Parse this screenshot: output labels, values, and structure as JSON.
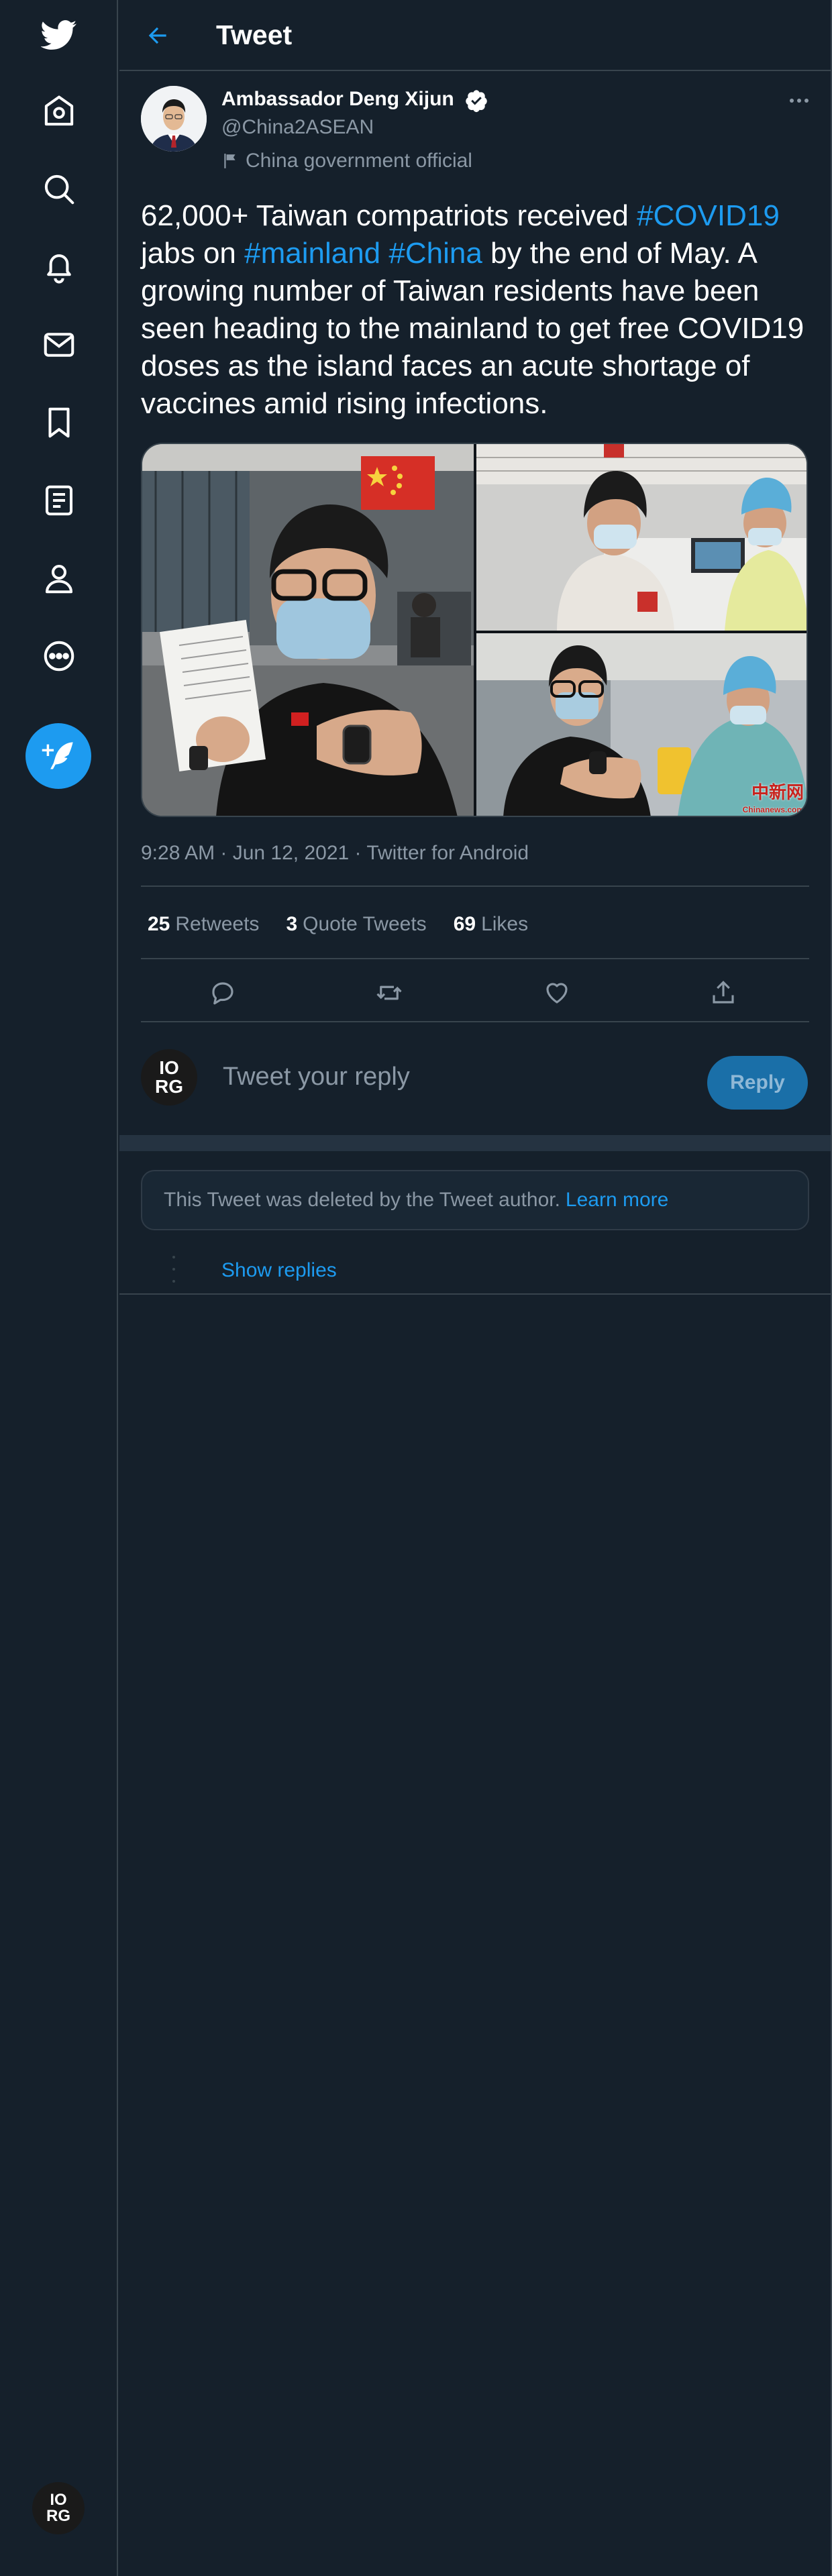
{
  "nav": {
    "items": [
      {
        "name": "twitter-logo-icon"
      },
      {
        "name": "home-icon"
      },
      {
        "name": "explore-icon"
      },
      {
        "name": "notifications-icon"
      },
      {
        "name": "messages-icon"
      },
      {
        "name": "bookmarks-icon"
      },
      {
        "name": "lists-icon"
      },
      {
        "name": "profile-icon"
      },
      {
        "name": "more-icon"
      }
    ],
    "compose": {
      "name": "compose-tweet-icon"
    },
    "account_avatar_text": [
      "IO",
      "RG"
    ]
  },
  "header": {
    "title": "Tweet"
  },
  "tweet": {
    "author_name": "Ambassador Deng Xijun",
    "handle": "@China2ASEAN",
    "label": "China government official",
    "text_parts": [
      {
        "text": "62,000+ Taiwan compatriots received ",
        "tag": false
      },
      {
        "text": "#COVID19",
        "tag": true
      },
      {
        "text": " jabs on ",
        "tag": false
      },
      {
        "text": "#mainland",
        "tag": true
      },
      {
        "text": " ",
        "tag": false
      },
      {
        "text": "#China",
        "tag": true
      },
      {
        "text": " by the end of May. A growing number of Taiwan residents have been seen heading to the mainland to get free COVID19 doses as the island faces an acute shortage of vaccines amid rising infections.",
        "tag": false
      }
    ],
    "media_watermark": "中新网",
    "media_watermark_sub": "Chinanews.com",
    "timestamp": "9:28 AM · Jun 12, 2021 · Twitter for Android",
    "stats": {
      "retweets_count": "25",
      "retweets_label": "Retweets",
      "quotes_count": "3",
      "quotes_label": "Quote Tweets",
      "likes_count": "69",
      "likes_label": "Likes"
    }
  },
  "reply": {
    "placeholder": "Tweet your reply",
    "button": "Reply",
    "avatar_text": [
      "IO",
      "RG"
    ]
  },
  "thread": {
    "deleted_notice": "This Tweet was deleted by the Tweet author.",
    "learn_more": "Learn more",
    "show_replies": "Show replies"
  },
  "colors": {
    "background": "#15202b",
    "accent": "#1d9bf0",
    "muted_text": "#8b98a5",
    "border": "#38444d"
  }
}
